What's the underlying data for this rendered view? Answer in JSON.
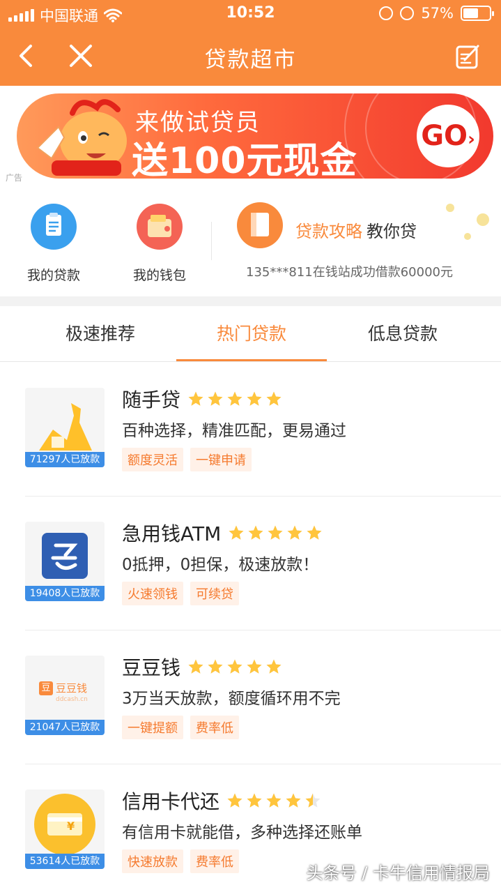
{
  "status_bar": {
    "carrier": "中国联通",
    "time": "10:52",
    "battery": "57%",
    "battery_level": 0.57
  },
  "header": {
    "title": "贷款超市",
    "back_icon": "chevron-left-icon",
    "close_icon": "close-icon",
    "edit_icon": "edit-icon"
  },
  "banner": {
    "line1": "来做试贷员",
    "line2": "送100元现金",
    "go": "GO",
    "ad_label": "广告"
  },
  "quick_links": {
    "my_loans": "我的贷款",
    "my_wallet": "我的钱包",
    "strategy_highlight": "贷款攻略",
    "strategy_sub": "教你贷",
    "ticker": "135***811在钱站成功借款60000元"
  },
  "tabs": [
    {
      "label": "极速推荐",
      "active": false
    },
    {
      "label": "热门贷款",
      "active": true
    },
    {
      "label": "低息贷款",
      "active": false
    }
  ],
  "loans": [
    {
      "name": "随手贷",
      "rating": 5,
      "desc": "百种选择，精准匹配，更易通过",
      "count": "71297人已放款",
      "tags": [
        "额度灵活",
        "一键申请"
      ]
    },
    {
      "name": "急用钱ATM",
      "rating": 5,
      "desc": "0抵押，0担保，极速放款！",
      "count": "19408人已放款",
      "tags": [
        "火速领钱",
        "可续贷"
      ]
    },
    {
      "name": "豆豆钱",
      "rating": 5,
      "desc": "3万当天放款，额度循环用不完",
      "count": "21047人已放款",
      "tags": [
        "一键提额",
        "费率低"
      ],
      "logo_text": "豆豆钱",
      "logo_sub": "ddcash.cn",
      "logo_badge": "豆"
    },
    {
      "name": "信用卡代还",
      "rating": 4.5,
      "desc": "有信用卡就能借，多种选择还账单",
      "count": "53614人已放款",
      "tags": [
        "快速放款",
        "费率低"
      ],
      "logo_symbol": "¥"
    }
  ],
  "watermark": "头条号 / 卡牛信用情报局",
  "colors": {
    "accent": "#f98a3c",
    "badge_blue": "#3d8ee6",
    "star": "#ffc53d",
    "tag_bg": "#fff1e8"
  }
}
